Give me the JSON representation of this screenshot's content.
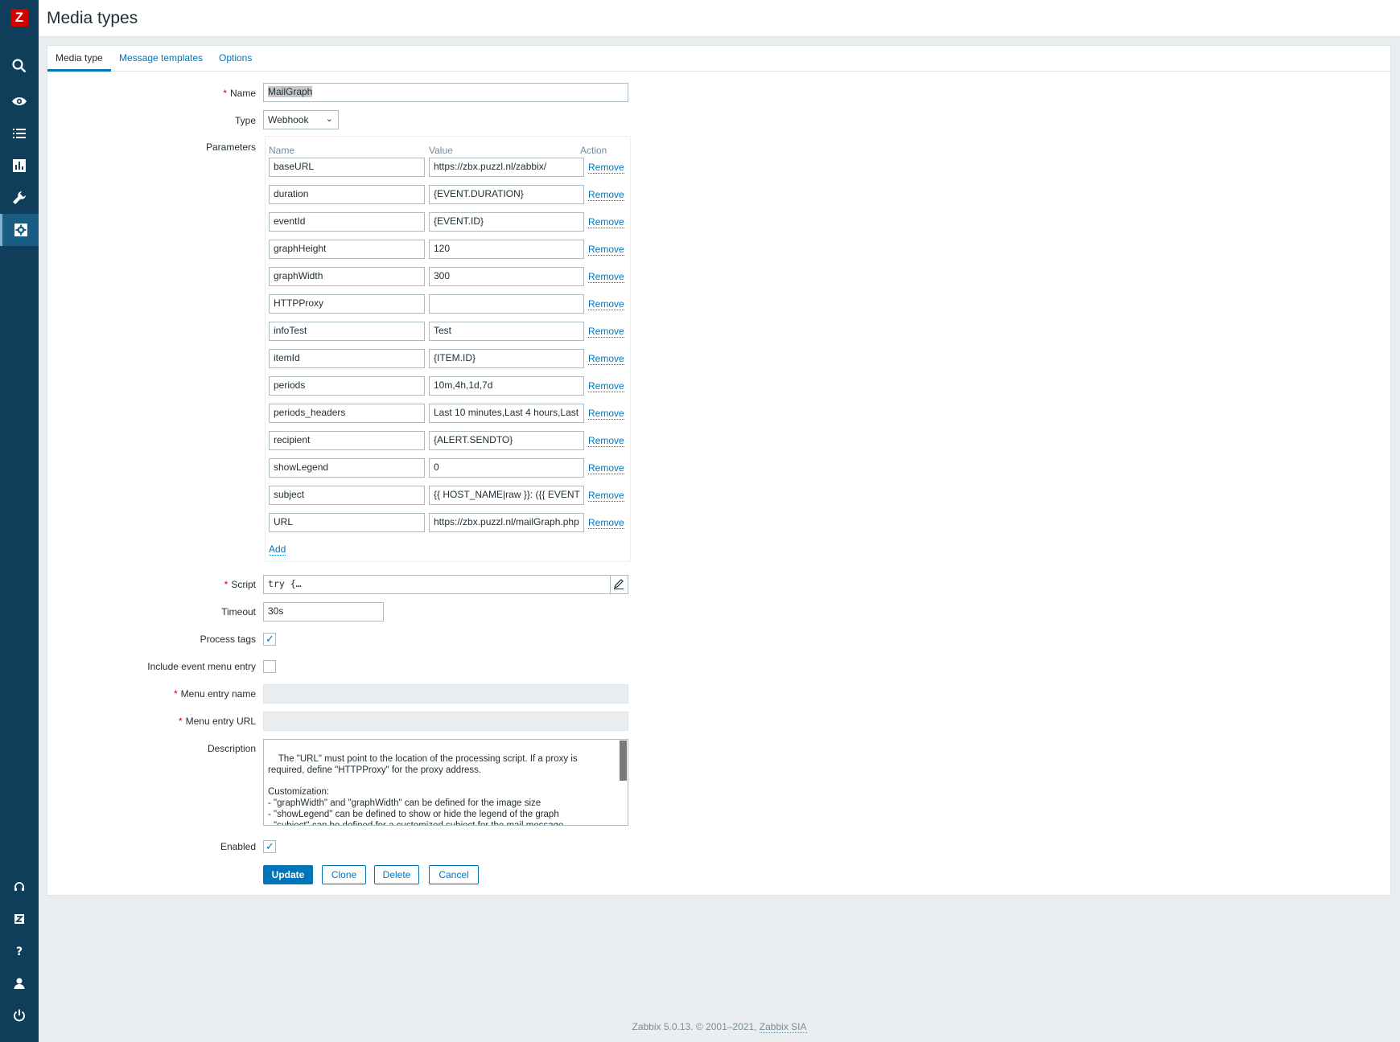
{
  "header": {
    "title": "Media types",
    "logo": "Z"
  },
  "sidebar": {
    "icons": [
      "search-icon",
      "eye-icon",
      "list-icon",
      "chart-icon",
      "wrench-icon",
      "gear-icon",
      "headset-icon",
      "zabbix-icon",
      "help-icon",
      "user-icon",
      "power-icon"
    ]
  },
  "tabs": [
    {
      "label": "Media type"
    },
    {
      "label": "Message templates"
    },
    {
      "label": "Options"
    }
  ],
  "form": {
    "name_label": "Name",
    "name_value": "MailGraph",
    "type_label": "Type",
    "type_value": "Webhook",
    "parameters_label": "Parameters",
    "param_headers": {
      "name": "Name",
      "value": "Value",
      "action": "Action"
    },
    "params": [
      {
        "name": "baseURL",
        "value": "https://zbx.puzzl.nl/zabbix/",
        "action": "Remove"
      },
      {
        "name": "duration",
        "value": "{EVENT.DURATION}",
        "action": "Remove"
      },
      {
        "name": "eventId",
        "value": "{EVENT.ID}",
        "action": "Remove"
      },
      {
        "name": "graphHeight",
        "value": "120",
        "action": "Remove"
      },
      {
        "name": "graphWidth",
        "value": "300",
        "action": "Remove"
      },
      {
        "name": "HTTPProxy",
        "value": "",
        "action": "Remove"
      },
      {
        "name": "infoTest",
        "value": "Test",
        "action": "Remove"
      },
      {
        "name": "itemId",
        "value": "{ITEM.ID}",
        "action": "Remove"
      },
      {
        "name": "periods",
        "value": "10m,4h,1d,7d",
        "action": "Remove"
      },
      {
        "name": "periods_headers",
        "value": "Last 10 minutes,Last 4 hours,Last",
        "action": "Remove"
      },
      {
        "name": "recipient",
        "value": "{ALERT.SENDTO}",
        "action": "Remove"
      },
      {
        "name": "showLegend",
        "value": "0",
        "action": "Remove"
      },
      {
        "name": "subject",
        "value": "{{ HOST_NAME|raw }}: ({{ EVENT",
        "action": "Remove"
      },
      {
        "name": "URL",
        "value": "https://zbx.puzzl.nl/mailGraph.php",
        "action": "Remove"
      }
    ],
    "add_label": "Add",
    "script_label": "Script",
    "script_value": "try {…",
    "timeout_label": "Timeout",
    "timeout_value": "30s",
    "process_tags_label": "Process tags",
    "process_tags_checked": true,
    "event_menu_label": "Include event menu entry",
    "event_menu_checked": false,
    "menu_entry_name_label": "Menu entry name",
    "menu_entry_url_label": "Menu entry URL",
    "description_label": "Description",
    "description_value": "The \"URL\" must point to the location of the processing script. If a proxy is required, define \"HTTPProxy\" for the proxy address.\n\nCustomization:\n- \"graphWidth\" and \"graphWidth\" can be defined for the image size\n- \"showLegend\" can be defined to show or hide the legend of the graph\n- \"subject\" can be defined for a customized subject for the mail message",
    "enabled_label": "Enabled",
    "enabled_checked": true
  },
  "buttons": {
    "update": "Update",
    "clone": "Clone",
    "delete": "Delete",
    "cancel": "Cancel"
  },
  "footer": {
    "text": "Zabbix 5.0.13. © 2001–2021, ",
    "link": "Zabbix SIA"
  },
  "colors": {
    "sidebar": "#0e3e59",
    "accent": "#0275b8",
    "required": "#d40000"
  }
}
